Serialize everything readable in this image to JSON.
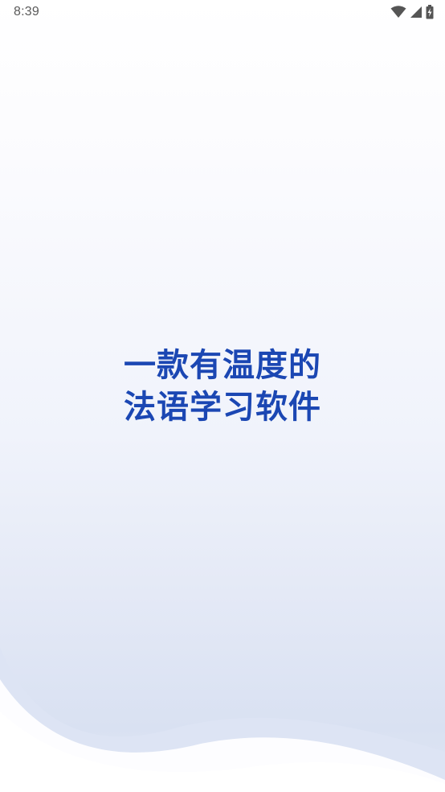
{
  "status_bar": {
    "time": "8:39",
    "icons": [
      "wifi-icon",
      "signal-icon",
      "battery-charging-icon"
    ]
  },
  "splash": {
    "tagline_line1": "一款有温度的",
    "tagline_line2": "法语学习软件"
  },
  "colors": {
    "tagline": "#1b47b3",
    "wave_light": "#e8edf8",
    "wave_dark": "#d3dcf0",
    "background_top": "#ffffff"
  }
}
